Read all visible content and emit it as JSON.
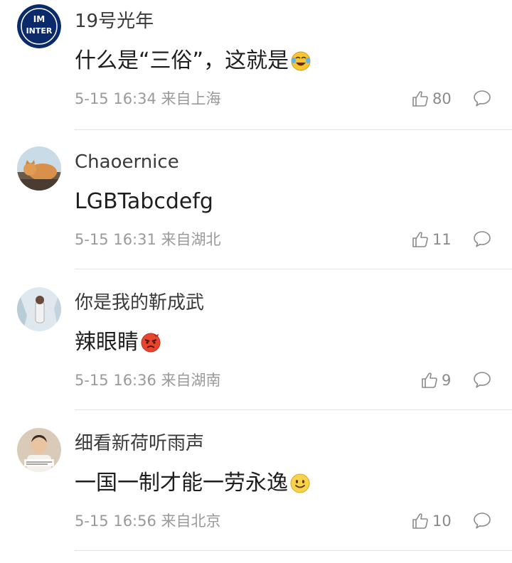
{
  "comments": [
    {
      "username": "19号光年",
      "text": "什么是“三俗”，这就是",
      "emoji": "tears-of-joy-emoji",
      "meta": "5-15 16:34 来自上海",
      "likes": "80",
      "avatar": "inter-logo-avatar"
    },
    {
      "username": "Chaoernice",
      "text": "LGBTabcdefg",
      "emoji": "",
      "meta": "5-15 16:31 来自湖北",
      "likes": "11",
      "avatar": "cat-photo-avatar"
    },
    {
      "username": "你是我的靳成武",
      "text": "辣眼睛",
      "emoji": "angry-face-emoji",
      "meta": "5-15 16:36 来自湖南",
      "likes": "9",
      "avatar": "snow-photo-avatar"
    },
    {
      "username": "细看新荷听雨声",
      "text": "一国一制才能一劳永逸",
      "emoji": "smile-emoji",
      "meta": "5-15 16:56 来自北京",
      "likes": "10",
      "avatar": "meme-photo-avatar"
    }
  ],
  "avatar_labels": {
    "inter_logo": "INTER"
  },
  "colors": {
    "text_primary": "#1e1e1e",
    "text_username": "#3a3a3a",
    "text_meta": "#9a9a9a",
    "divider": "#e4e4e4",
    "inter_blue": "#0b2a6b"
  }
}
